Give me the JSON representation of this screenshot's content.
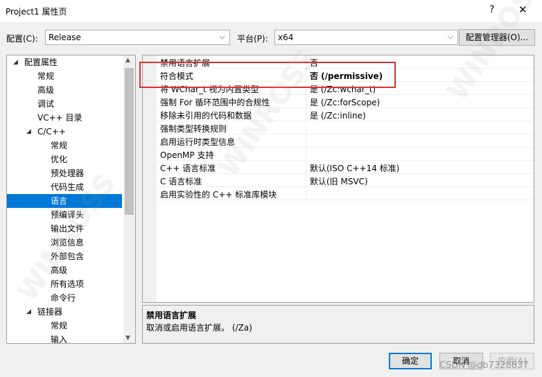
{
  "window": {
    "title": "Project1 属性页",
    "help": "?",
    "close": "✕"
  },
  "toolbar": {
    "config_label": "配置(C):",
    "config_value": "Release",
    "platform_label": "平台(P):",
    "platform_value": "x64",
    "config_manager": "配置管理器(O)..."
  },
  "tree": {
    "nodes": [
      {
        "label": "配置属性",
        "expand": "◢"
      },
      {
        "label": "常规"
      },
      {
        "label": "高级"
      },
      {
        "label": "调试"
      },
      {
        "label": "VC++ 目录"
      },
      {
        "label": "C/C++",
        "expand": "◢"
      },
      {
        "label": "常规"
      },
      {
        "label": "优化"
      },
      {
        "label": "预处理器"
      },
      {
        "label": "代码生成"
      },
      {
        "label": "语言"
      },
      {
        "label": "预编译头"
      },
      {
        "label": "输出文件"
      },
      {
        "label": "浏览信息"
      },
      {
        "label": "外部包含"
      },
      {
        "label": "高级"
      },
      {
        "label": "所有选项"
      },
      {
        "label": "命令行"
      },
      {
        "label": "链接器",
        "expand": "◢"
      },
      {
        "label": "常规"
      },
      {
        "label": "输入"
      }
    ],
    "selected_index": 10
  },
  "grid": {
    "rows": [
      {
        "name": "禁用语言扩展",
        "value": "否"
      },
      {
        "name": "符合模式",
        "value": "否 (/permissive)"
      },
      {
        "name": "将 WChar_t 视为内置类型",
        "value": "是 (/Zc:wchar_t)"
      },
      {
        "name": "强制 For 循环范围中的合规性",
        "value": "是 (/Zc:forScope)"
      },
      {
        "name": "移除未引用的代码和数据",
        "value": "是 (/Zc:inline)"
      },
      {
        "name": "强制类型转换规则",
        "value": ""
      },
      {
        "name": "启用运行时类型信息",
        "value": ""
      },
      {
        "name": "OpenMP 支持",
        "value": ""
      },
      {
        "name": "C++ 语言标准",
        "value": "默认(ISO C++14 标准)"
      },
      {
        "name": "C 语言标准",
        "value": "默认(旧 MSVC)"
      },
      {
        "name": "启用实验性的 C++ 标准库模块",
        "value": ""
      }
    ]
  },
  "description": {
    "title": "禁用语言扩展",
    "text": "取消或启用语言扩展。    (/Za)"
  },
  "buttons": {
    "ok": "确定",
    "cancel": "取消",
    "apply": "应用(A)"
  },
  "watermark": {
    "text": "WINROSS",
    "footer": "CSDN @db7328837"
  },
  "colors": {
    "selection": "#0078d7",
    "highlight_box": "#e0302a"
  }
}
